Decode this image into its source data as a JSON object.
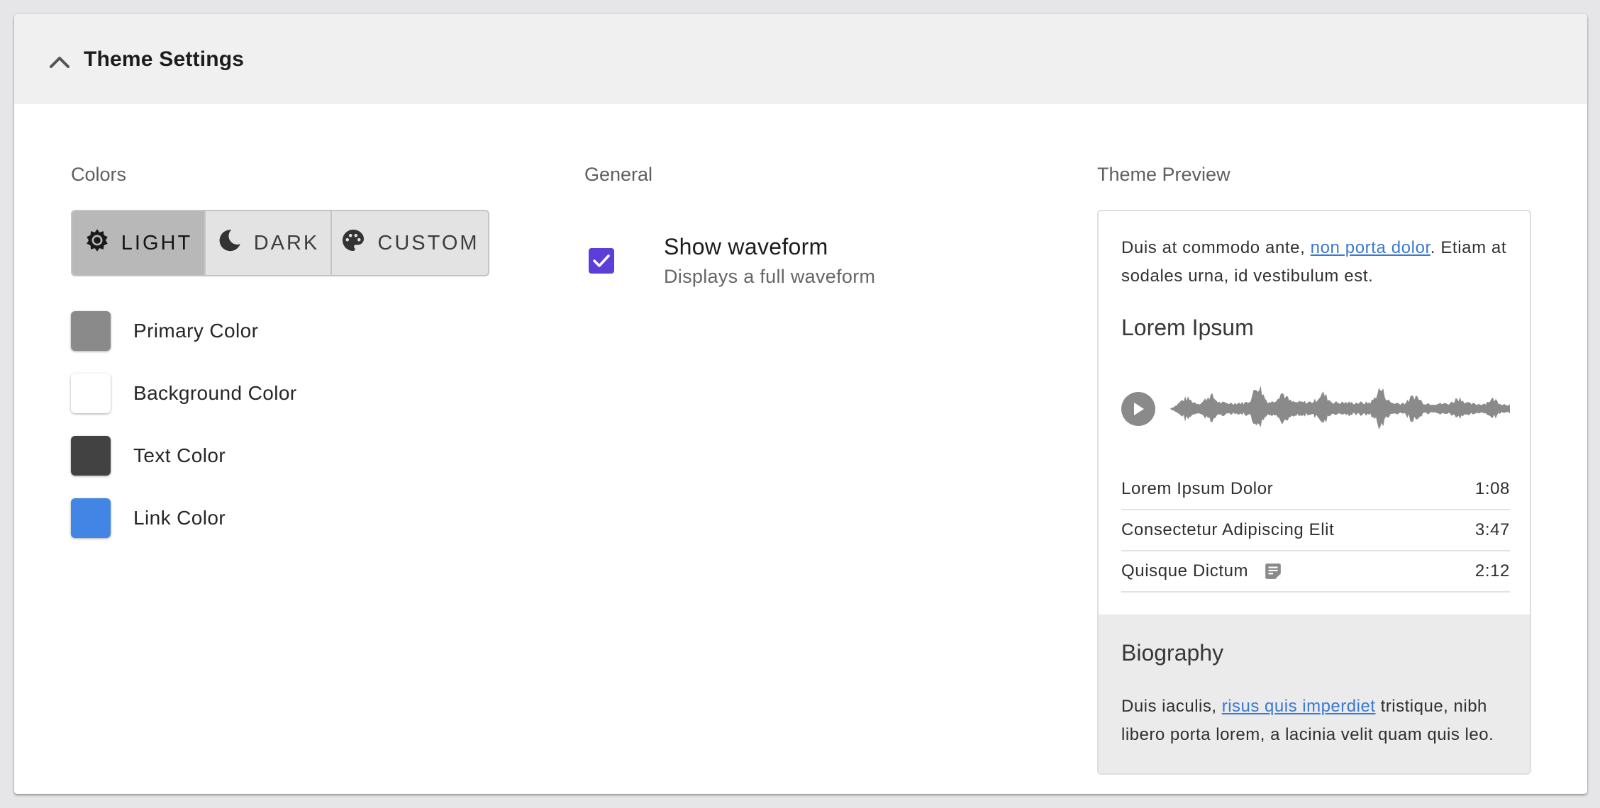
{
  "header": {
    "title": "Theme Settings",
    "icon": "chevron-up-icon"
  },
  "colors_section": {
    "label": "Colors",
    "theme_buttons": [
      {
        "label": "LIGHT",
        "icon": "sun-icon",
        "active": true
      },
      {
        "label": "DARK",
        "icon": "moon-icon",
        "active": false
      },
      {
        "label": "CUSTOM",
        "icon": "palette-icon",
        "active": false
      }
    ],
    "colors": [
      {
        "label": "Primary Color",
        "value": "#8a8a8a"
      },
      {
        "label": "Background Color",
        "value": "#ffffff"
      },
      {
        "label": "Text Color",
        "value": "#424242"
      },
      {
        "label": "Link Color",
        "value": "#4285e4"
      }
    ]
  },
  "general_section": {
    "label": "General",
    "option": {
      "title": "Show waveform",
      "subtitle": "Displays a full waveform",
      "checked": true,
      "checkbox_color": "#5b3fd8"
    }
  },
  "preview_section": {
    "label": "Theme Preview",
    "intro_before": "Duis at commodo ante, ",
    "intro_link": "non porta dolor",
    "intro_after": ". Etiam at sodales urna, id vestibulum est.",
    "album_title": "Lorem Ipsum",
    "tracks": [
      {
        "name": "Lorem Ipsum Dolor",
        "duration": "1:08",
        "has_lyrics": false
      },
      {
        "name": "Consectetur Adipiscing Elit",
        "duration": "3:47",
        "has_lyrics": false
      },
      {
        "name": "Quisque Dictum",
        "duration": "2:12",
        "has_lyrics": true
      }
    ],
    "bio_title": "Biography",
    "bio_before": "Duis iaculis, ",
    "bio_link": "risus quis imperdiet",
    "bio_after": " tristique, nibh libero porta lorem, a lacinia velit quam quis leo.",
    "link_color": "#3b78d0",
    "accent_color": "#8a8a8a"
  }
}
